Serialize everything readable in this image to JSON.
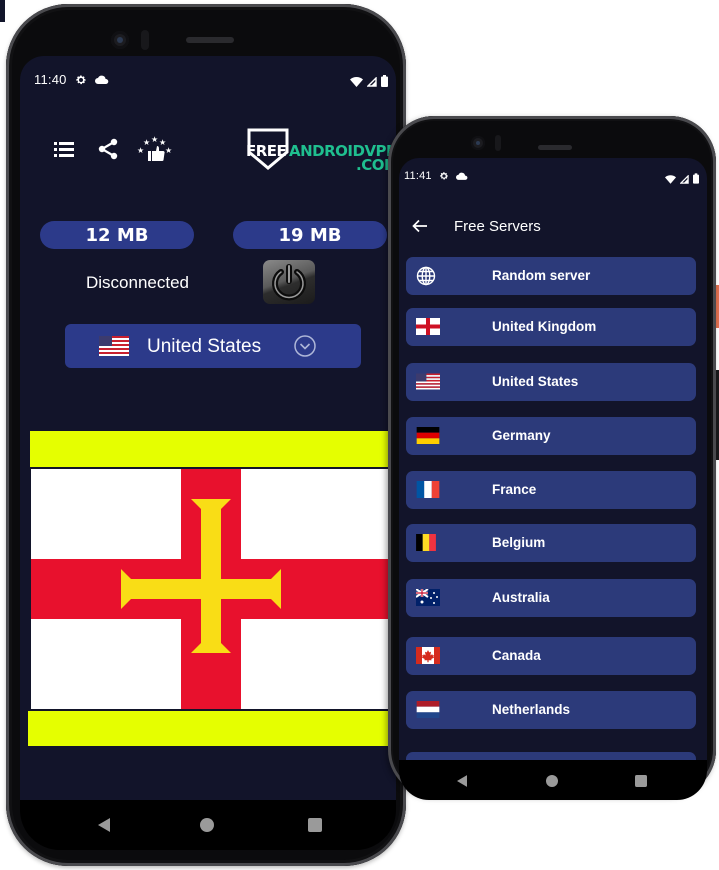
{
  "phone_main": {
    "status_bar": {
      "time": "11:40"
    },
    "toolbar": {
      "menu_icon": "list-icon",
      "share_icon": "share-icon",
      "rate_icon": "rate-stars-thumbs-up-icon"
    },
    "logo": {
      "part1": "FREE",
      "part2": "ANDROIDVPN",
      "part3": ".COM"
    },
    "data_usage": {
      "download": "12 MB",
      "upload": "19 MB"
    },
    "connection": {
      "status": "Disconnected",
      "power_button_icon": "power-icon"
    },
    "country_selector": {
      "selected": "United States",
      "flag": "us-flag",
      "chevron_icon": "chevron-down-circle-icon"
    },
    "banner": {
      "flag": "guernsey-flag",
      "stripe_color": "#e5ff00"
    },
    "nav": {
      "back": "back-icon",
      "home": "home-icon",
      "recents": "recents-icon"
    }
  },
  "phone_servers": {
    "status_bar": {
      "time": "11:41"
    },
    "header": {
      "title": "Free Servers",
      "back_icon": "arrow-left-icon"
    },
    "servers": [
      {
        "label": "Random server",
        "icon": "globe-icon"
      },
      {
        "label": "United Kingdom",
        "icon": "england-flag"
      },
      {
        "label": "United States",
        "icon": "us-flag"
      },
      {
        "label": "Germany",
        "icon": "germany-flag"
      },
      {
        "label": "France",
        "icon": "france-flag"
      },
      {
        "label": "Belgium",
        "icon": "belgium-flag"
      },
      {
        "label": "Australia",
        "icon": "australia-flag"
      },
      {
        "label": "Canada",
        "icon": "canada-flag"
      },
      {
        "label": "Netherlands",
        "icon": "netherlands-flag"
      }
    ]
  },
  "colors": {
    "background": "#12142a",
    "accent": "#2c3a8a",
    "list_item": "#2c3a7a",
    "logo_green": "#1fbf8f",
    "banner_yellow": "#e5ff00",
    "guernsey_red": "#e8112d",
    "guernsey_gold": "#f9dd16"
  }
}
